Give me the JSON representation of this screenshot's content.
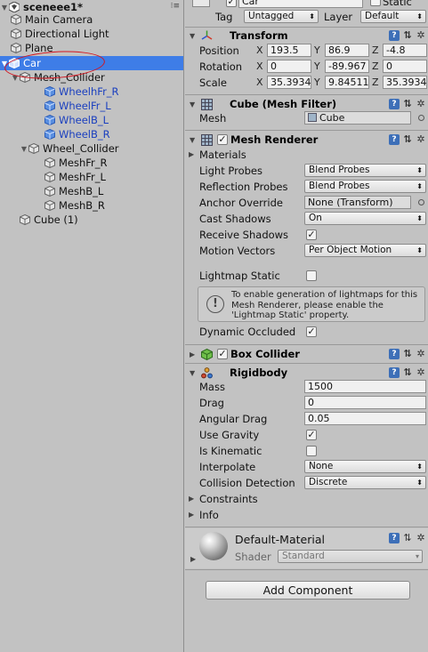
{
  "hierarchy": {
    "scene": "sceneee1*",
    "items": [
      {
        "label": "Main Camera"
      },
      {
        "label": "Directional Light"
      },
      {
        "label": "Plane"
      },
      {
        "label": "Car"
      },
      {
        "label": "Mesh_Collider"
      },
      {
        "label": "WheelhFr_R"
      },
      {
        "label": "WheelFr_L"
      },
      {
        "label": "WheelB_L"
      },
      {
        "label": "WheelB_R"
      },
      {
        "label": "Wheel_Collider"
      },
      {
        "label": "MeshFr_R"
      },
      {
        "label": "MeshFr_L"
      },
      {
        "label": "MeshB_L"
      },
      {
        "label": "MeshB_R"
      },
      {
        "label": "Cube (1)"
      }
    ]
  },
  "inspector": {
    "object_name": "Car",
    "static_label": "Static",
    "tag_label": "Tag",
    "tag_value": "Untagged",
    "layer_label": "Layer",
    "layer_value": "Default",
    "transform": {
      "title": "Transform",
      "position_label": "Position",
      "rotation_label": "Rotation",
      "scale_label": "Scale",
      "axes": [
        "X",
        "Y",
        "Z"
      ],
      "position": [
        "193.5",
        "86.9",
        "-4.8"
      ],
      "rotation": [
        "0",
        "-89.967",
        "0"
      ],
      "scale": [
        "35.3934",
        "9.84511",
        "35.3934"
      ]
    },
    "mesh_filter": {
      "title": "Cube (Mesh Filter)",
      "mesh_label": "Mesh",
      "mesh_value": "Cube"
    },
    "mesh_renderer": {
      "title": "Mesh Renderer",
      "materials_label": "Materials",
      "light_probes_label": "Light Probes",
      "light_probes_value": "Blend Probes",
      "reflection_probes_label": "Reflection Probes",
      "reflection_probes_value": "Blend Probes",
      "anchor_override_label": "Anchor Override",
      "anchor_override_value": "None (Transform)",
      "cast_shadows_label": "Cast Shadows",
      "cast_shadows_value": "On",
      "receive_shadows_label": "Receive Shadows",
      "motion_vectors_label": "Motion Vectors",
      "motion_vectors_value": "Per Object Motion",
      "lightmap_static_label": "Lightmap Static",
      "help_text": "To enable generation of lightmaps for this Mesh Renderer, please enable the 'Lightmap Static' property.",
      "dynamic_occluded_label": "Dynamic Occluded"
    },
    "box_collider": {
      "title": "Box Collider"
    },
    "rigidbody": {
      "title": "Rigidbody",
      "mass_label": "Mass",
      "mass_value": "1500",
      "drag_label": "Drag",
      "drag_value": "0",
      "angular_drag_label": "Angular Drag",
      "angular_drag_value": "0.05",
      "use_gravity_label": "Use Gravity",
      "is_kinematic_label": "Is Kinematic",
      "interpolate_label": "Interpolate",
      "interpolate_value": "None",
      "collision_detection_label": "Collision Detection",
      "collision_detection_value": "Discrete",
      "constraints_label": "Constraints",
      "info_label": "Info"
    },
    "material": {
      "name": "Default-Material",
      "shader_label": "Shader",
      "shader_value": "Standard"
    },
    "add_component_label": "Add Component"
  },
  "colors": {
    "selection": "#3e7de7",
    "prefab_text": "#1a3fbf",
    "annotation": "#d3141e"
  }
}
